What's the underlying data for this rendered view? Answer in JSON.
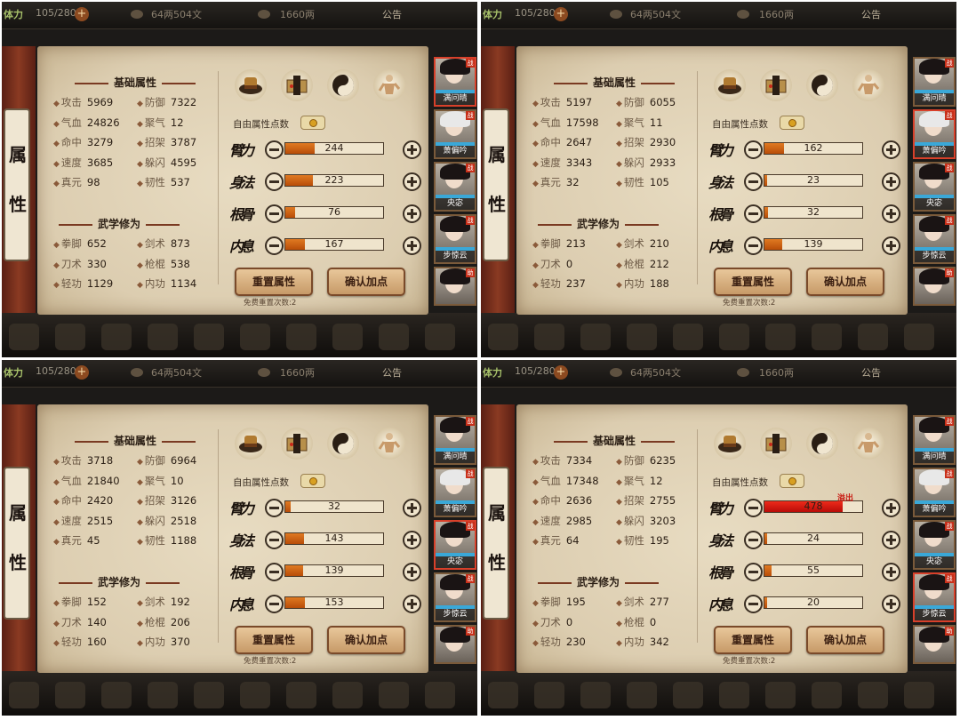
{
  "common": {
    "stamina_label": "体力",
    "stamina_value": "105/280",
    "silver": "64两504文",
    "gold": "1660两",
    "notice": "公告",
    "left_tab": "属性",
    "section_basic": "基础属性",
    "section_martial": "武学修为",
    "free_points_label": "自由属性点数",
    "reset_label": "重置属性",
    "confirm_label": "确认加点",
    "free_reset": "免费重置次数:2",
    "icons": [
      "hat-icon",
      "manual-icon",
      "taiji-icon",
      "body-icon"
    ],
    "attribute_glyphs": [
      "臂力",
      "身法",
      "根骨",
      "内息"
    ],
    "roster": [
      {
        "name": "满问晴"
      },
      {
        "name": "萧偏吟"
      },
      {
        "name": "央宓"
      },
      {
        "name": "步惊云"
      },
      {
        "name": ""
      }
    ]
  },
  "screenshots": [
    {
      "basic": {
        "攻击": "5969",
        "防御": "7322",
        "气血": "24826",
        "聚气": "12",
        "命中": "3279",
        "招架": "3787",
        "速度": "3685",
        "躲闪": "4595",
        "真元": "98",
        "韧性": "537"
      },
      "martial": {
        "拳脚": "652",
        "剑术": "873",
        "刀术": "330",
        "枪棍": "538",
        "轻功": "1129",
        "内功": "1134"
      },
      "attr_values": [
        244,
        223,
        76,
        167
      ],
      "attr_fill": [
        0.3,
        0.28,
        0.1,
        0.2
      ],
      "overflow": [
        false,
        false,
        false,
        false
      ],
      "selected_hero": 0
    },
    {
      "basic": {
        "攻击": "5197",
        "防御": "6055",
        "气血": "17598",
        "聚气": "11",
        "命中": "2647",
        "招架": "2930",
        "速度": "3343",
        "躲闪": "2933",
        "真元": "32",
        "韧性": "105"
      },
      "martial": {
        "拳脚": "213",
        "剑术": "210",
        "刀术": "0",
        "枪棍": "212",
        "轻功": "237",
        "内功": "188"
      },
      "attr_values": [
        162,
        23,
        32,
        139
      ],
      "attr_fill": [
        0.2,
        0.03,
        0.04,
        0.18
      ],
      "overflow": [
        false,
        false,
        false,
        false
      ],
      "selected_hero": 1
    },
    {
      "basic": {
        "攻击": "3718",
        "防御": "6964",
        "气血": "21840",
        "聚气": "10",
        "命中": "2420",
        "招架": "3126",
        "速度": "2515",
        "躲闪": "2518",
        "真元": "45",
        "韧性": "1188"
      },
      "martial": {
        "拳脚": "152",
        "剑术": "192",
        "刀术": "140",
        "枪棍": "206",
        "轻功": "160",
        "内功": "370"
      },
      "attr_values": [
        32,
        143,
        139,
        153
      ],
      "attr_fill": [
        0.05,
        0.19,
        0.18,
        0.2
      ],
      "overflow": [
        false,
        false,
        false,
        false
      ],
      "selected_hero": 2
    },
    {
      "basic": {
        "攻击": "7334",
        "防御": "6235",
        "气血": "17348",
        "聚气": "12",
        "命中": "2636",
        "招架": "2755",
        "速度": "2985",
        "躲闪": "3203",
        "真元": "64",
        "韧性": "195"
      },
      "martial": {
        "拳脚": "195",
        "剑术": "277",
        "刀术": "0",
        "枪棍": "0",
        "轻功": "230",
        "内功": "342"
      },
      "attr_values": [
        478,
        24,
        55,
        20
      ],
      "attr_fill": [
        0.8,
        0.03,
        0.07,
        0.03
      ],
      "overflow": [
        true,
        false,
        false,
        false
      ],
      "overflow_label": "溢出",
      "selected_hero": 3
    }
  ]
}
